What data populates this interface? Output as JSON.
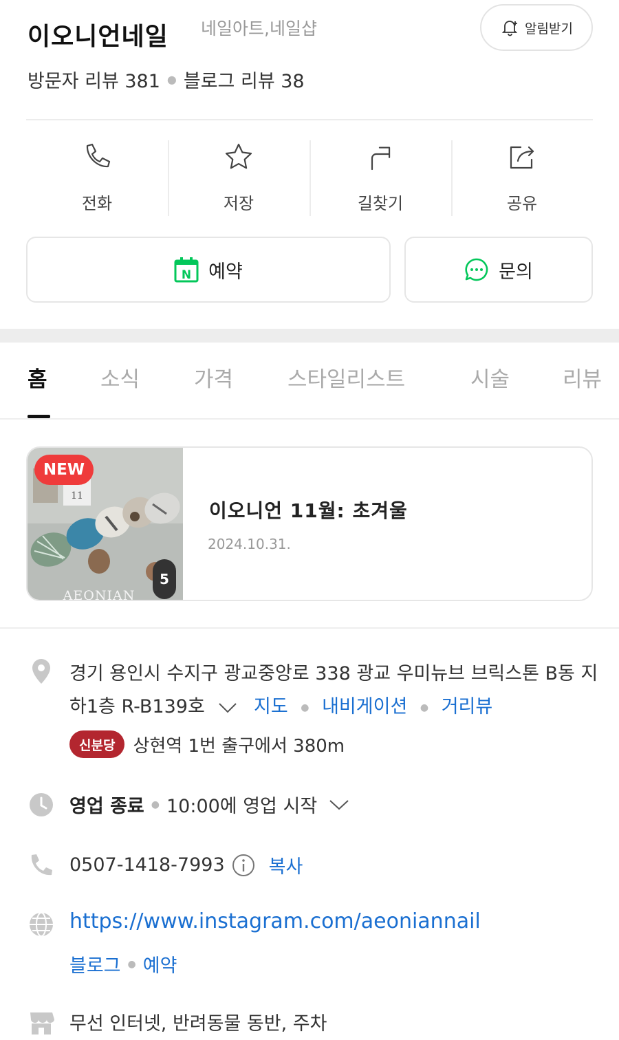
{
  "header": {
    "name": "이오니언네일",
    "category": "네일아트,네일샵",
    "notify_label": "알림받기"
  },
  "reviews": {
    "visitor": "방문자 리뷰 381",
    "blog": "블로그 리뷰 38"
  },
  "actions": [
    {
      "label": "전화",
      "icon": "phone-icon"
    },
    {
      "label": "저장",
      "icon": "star-icon"
    },
    {
      "label": "길찾기",
      "icon": "directions-icon"
    },
    {
      "label": "공유",
      "icon": "share-icon"
    }
  ],
  "buttons": {
    "reserve": "예약",
    "inquiry": "문의"
  },
  "tabs": [
    "홈",
    "소식",
    "가격",
    "스타일리스트",
    "시술",
    "리뷰"
  ],
  "news": {
    "badge": "NEW",
    "count": "5",
    "title": "이오니언 11월: 초겨울",
    "date": "2024.10.31.",
    "thumb_text": "AEONIAN",
    "thumb_card_text": "11"
  },
  "info": {
    "address": "경기 용인시 수지구 광교중앙로 338 광교 우미뉴브 브릭스톤 B동 지하1층 R-B139호",
    "address_links": [
      "지도",
      "내비게이션",
      "거리뷰"
    ],
    "subway_line": "신분당",
    "subway_text": "상현역 1번 출구에서 380m",
    "hours_status": "영업 종료",
    "hours_next": "10:00에 영업 시작",
    "phone": "0507-1418-7993",
    "copy_label": "복사",
    "website": "https://www.instagram.com/aeoniannail",
    "site_links": [
      "블로그",
      "예약"
    ],
    "amenities": "무선 인터넷, 반려동물 동반, 주차"
  },
  "colors": {
    "link": "#1a6fd1",
    "naver_green": "#03c75a",
    "new_badge": "#ef3b3b",
    "subway_badge": "#b3262f"
  }
}
